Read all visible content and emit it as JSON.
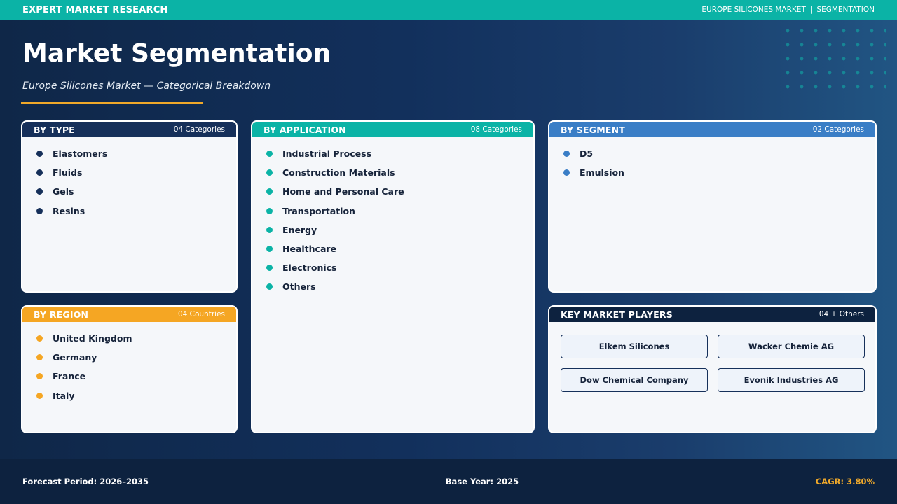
{
  "header": {
    "brand": "EXPERT MARKET RESEARCH",
    "breadcrumb_market": "EUROPE SILICONES MARKET",
    "breadcrumb_sep": "|",
    "breadcrumb_section": "SEGMENTATION"
  },
  "page": {
    "title": "Market Segmentation",
    "subtitle": "Europe Silicones Market — Categorical Breakdown"
  },
  "colors": {
    "teal": "#0bb3a6",
    "navy": "#16305a",
    "blue": "#3a7ec6",
    "orange": "#f5a623",
    "dark": "#0d223f"
  },
  "by_type": {
    "title": "BY TYPE",
    "count": "04 Categories",
    "items": [
      "Elastomers",
      "Fluids",
      "Gels",
      "Resins"
    ]
  },
  "by_application": {
    "title": "BY APPLICATION",
    "count": "08 Categories",
    "items": [
      "Industrial Process",
      "Construction Materials",
      "Home and Personal Care",
      "Transportation",
      "Energy",
      "Healthcare",
      "Electronics",
      "Others"
    ]
  },
  "by_segment": {
    "title": "BY SEGMENT",
    "count": "02 Categories",
    "items": [
      "D5",
      "Emulsion"
    ]
  },
  "by_region": {
    "title": "BY REGION",
    "count": "04 Countries",
    "items": [
      "United Kingdom",
      "Germany",
      "France",
      "Italy"
    ]
  },
  "key_players": {
    "title": "KEY MARKET PLAYERS",
    "count": "04 + Others",
    "items": [
      "Elkem Silicones",
      "Wacker Chemie AG",
      "Dow Chemical Company",
      "Evonik Industries AG"
    ]
  },
  "footer": {
    "forecast": "Forecast Period: 2026–2035",
    "base_year": "Base Year: 2025",
    "cagr": "CAGR: 3.80%"
  }
}
